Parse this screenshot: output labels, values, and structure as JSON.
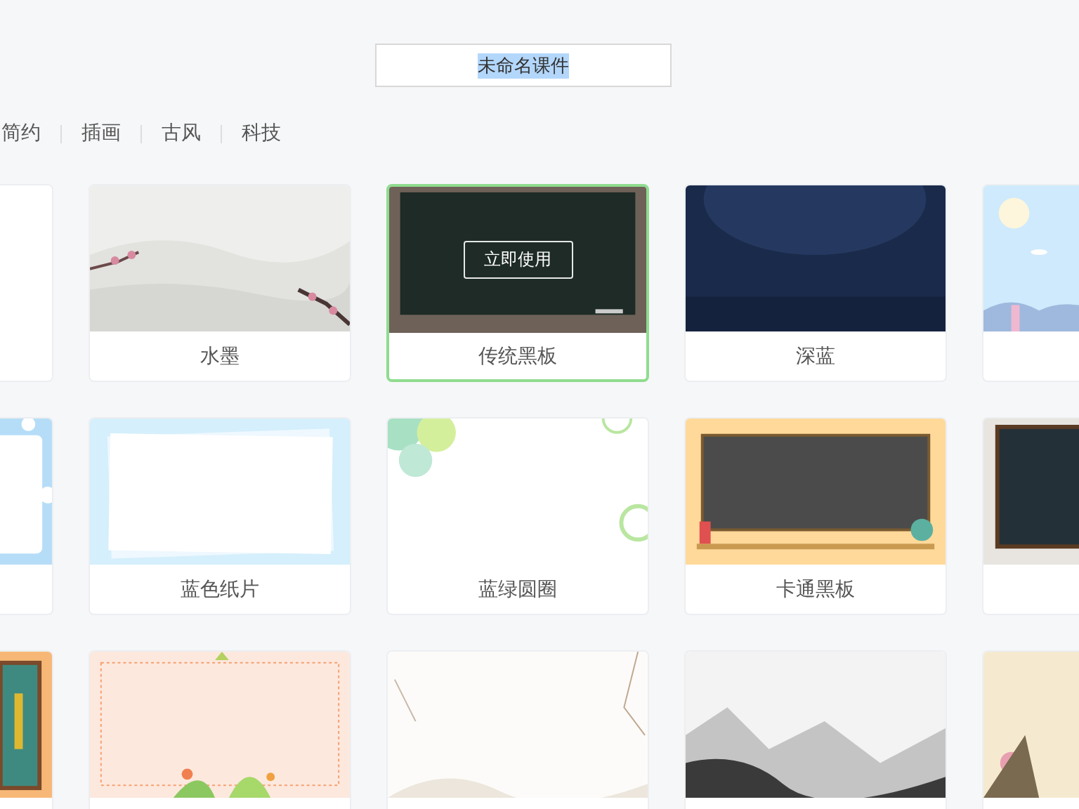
{
  "title_field": {
    "value": "未命名课件",
    "text_selected": true
  },
  "tabs": [
    {
      "label": "简约",
      "selected": false
    },
    {
      "label": "插画",
      "selected": false
    },
    {
      "label": "古风",
      "selected": false
    },
    {
      "label": "科技",
      "selected": false
    }
  ],
  "templates": [
    {
      "selected": false,
      "kind": "blank"
    },
    {
      "label": "水墨",
      "selected": false,
      "kind": "picture"
    },
    {
      "label": "传统黑板",
      "selected": true,
      "kind": "picture",
      "action": "立即使用"
    },
    {
      "label": "深蓝",
      "selected": false,
      "kind": "picture"
    },
    {
      "selected": false,
      "kind": "picture"
    },
    {
      "selected": false,
      "kind": "picture"
    },
    {
      "label": "蓝色纸片",
      "selected": false,
      "kind": "picture"
    },
    {
      "label": "蓝绿圆圈",
      "selected": false,
      "kind": "picture"
    },
    {
      "label": "卡通黑板",
      "selected": false,
      "kind": "picture"
    },
    {
      "selected": false,
      "kind": "picture"
    },
    {
      "selected": false,
      "kind": "picture"
    },
    {
      "selected": false,
      "kind": "picture"
    },
    {
      "selected": false,
      "kind": "picture"
    },
    {
      "selected": false,
      "kind": "picture"
    },
    {
      "selected": false,
      "kind": "picture"
    }
  ]
}
